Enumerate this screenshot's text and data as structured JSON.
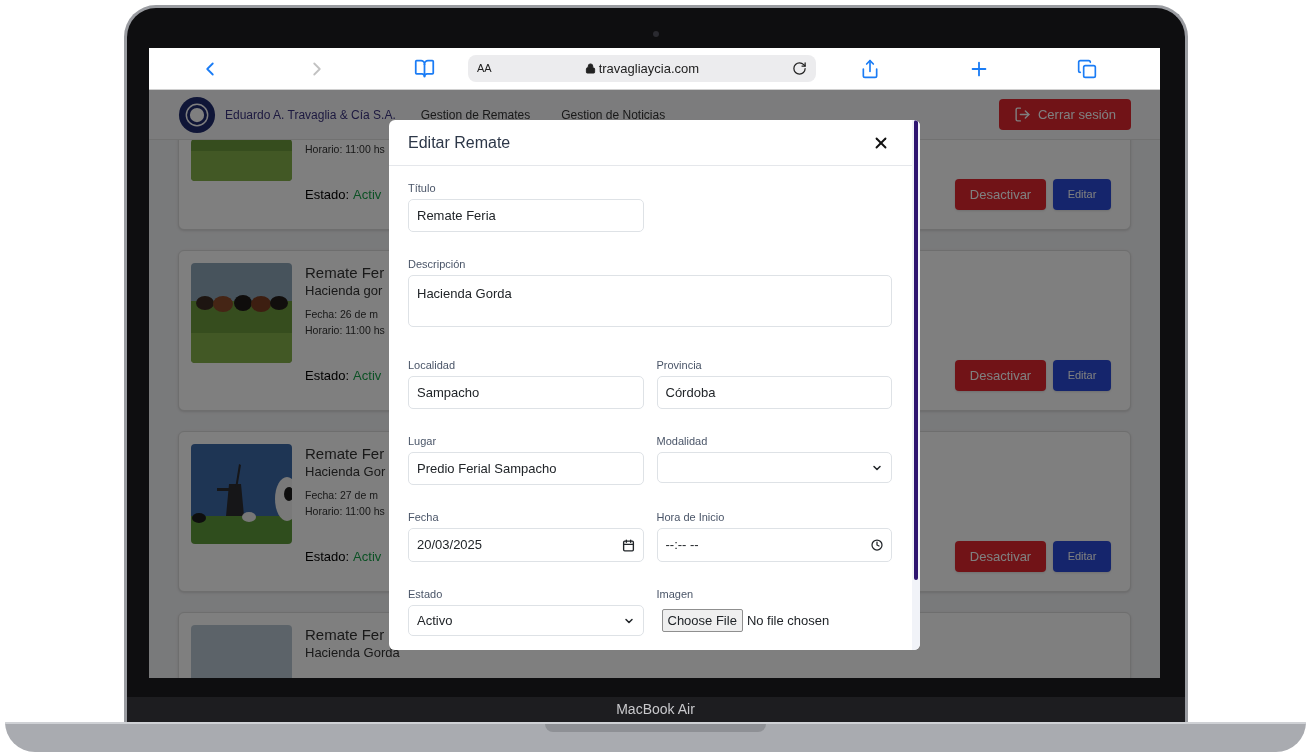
{
  "browser": {
    "text_size": "AA",
    "url": "travagliaycia.com"
  },
  "header": {
    "brand": "Eduardo A. Travaglia & Cía S.A.",
    "nav": [
      {
        "label": "Gestion de Remates"
      },
      {
        "label": "Gestion de Noticias"
      }
    ],
    "logout": "Cerrar sesión"
  },
  "cards": [
    {
      "horario": "Horario: 11:00 hs",
      "estado_label": "Estado:",
      "estado": "Activ",
      "buttons": [
        {
          "label": "Desactivar",
          "kind": "danger"
        },
        {
          "label": "Editar",
          "kind": "primary"
        }
      ]
    },
    {
      "title": "Remate Fer",
      "description": "Hacienda gor",
      "fecha": "Fecha: 26 de m",
      "horario": "Horario: 11:00 hs",
      "estado_label": "Estado:",
      "estado": "Activ",
      "buttons": [
        {
          "label": "Desactivar",
          "kind": "danger"
        },
        {
          "label": "Editar",
          "kind": "primary"
        }
      ]
    },
    {
      "title": "Remate Fer",
      "description": "Hacienda Gor",
      "fecha": "Fecha: 27 de m",
      "horario": "Horario: 11:00 hs",
      "estado_label": "Estado:",
      "estado": "Activ",
      "buttons": [
        {
          "label": "Desactivar",
          "kind": "danger"
        },
        {
          "label": "Editar",
          "kind": "primary"
        }
      ]
    },
    {
      "title": "Remate Fer",
      "description": "Hacienda Gorda"
    }
  ],
  "modal": {
    "title": "Editar Remate",
    "rows": [
      [
        {
          "label": "Título",
          "kind": "text",
          "value": "Remate Feria"
        }
      ],
      [
        {
          "label": "Descripción",
          "kind": "textarea",
          "value": "Hacienda Gorda"
        }
      ],
      [
        {
          "label": "Localidad",
          "kind": "text",
          "value": "Sampacho"
        },
        {
          "label": "Provincia",
          "kind": "text",
          "value": "Córdoba"
        }
      ],
      [
        {
          "label": "Lugar",
          "kind": "text",
          "value": "Predio Ferial Sampacho"
        },
        {
          "label": "Modalidad",
          "kind": "select"
        }
      ],
      [
        {
          "label": "Fecha",
          "kind": "date",
          "value": "20/03/2025"
        },
        {
          "label": "Hora de Inicio",
          "kind": "time",
          "value": "--:-- --"
        }
      ],
      [
        {
          "label": "Estado",
          "kind": "select",
          "value": "Activo"
        },
        {
          "label": "Imagen",
          "kind": "file",
          "button": "Choose File",
          "status": "No file chosen"
        }
      ]
    ]
  },
  "device": {
    "label": "MacBook Air"
  }
}
